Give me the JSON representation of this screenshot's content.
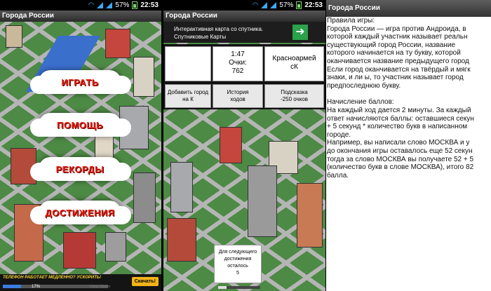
{
  "status": {
    "battery": "57%",
    "time": "22:53"
  },
  "screen1": {
    "title": "Города России",
    "menu": [
      "ИГРАТЬ",
      "ПОМОЩЬ",
      "РЕКОРДЫ",
      "ДОСТИЖЕНИЯ"
    ],
    "promo": {
      "text": "ТЕЛЕФОН РАБОТАЕТ МЕДЛЕННО? УСКОРИТЬ!",
      "progress": "17%",
      "progress_value": 0.17,
      "logo": "Clean Master",
      "download": "Скачать!"
    }
  },
  "screen2": {
    "title": "Города России",
    "ad": {
      "line1": "Интерактивная карта со спутника.",
      "line2": "Спутниковые Карты"
    },
    "input_value": "",
    "timer": "1:47",
    "score_label": "Очки:",
    "score": "762",
    "city_line1": "Красноармей",
    "city_line2": "сК",
    "buttons": {
      "add_city_line1": "Добавить город",
      "add_city_line2": "на К",
      "history_line1": "История",
      "history_line2": "ходов",
      "hint_line1": "Подсказка",
      "hint_line2": "-250 очков"
    },
    "achievement": {
      "l1": "Для следующего",
      "l2": "достижения",
      "l3": "осталось",
      "value": "5"
    }
  },
  "screen3": {
    "title": "Города России",
    "lines": [
      "Правила игры:",
      "Города России — игра против Андроида, в",
      "которой каждый участник называет реальн",
      "существующий город России, название",
      "которого начинается на ту букву, которой",
      "оканчивается название предыдущего город",
      "Если город оканчивается на твёрдый и мягк",
      "знаки, и ли ы, то участник называет город",
      "предпоследнюю букву.",
      "",
      "Начисление баллов:",
      "На каждый ход дается 2 минуты. За каждый",
      "ответ начисляются баллы: оставшиеся секун",
      "+ 5 секунд * количество букв в написанном",
      "городе.",
      "Например, вы написали слово МОСКВА и у",
      "до окончания игры оставалось еще 52 секун",
      "тогда за слово МОСКВА вы получаете 52 + 5",
      "(количество букв в слове МОСКВА), итого 82",
      "балла."
    ]
  }
}
